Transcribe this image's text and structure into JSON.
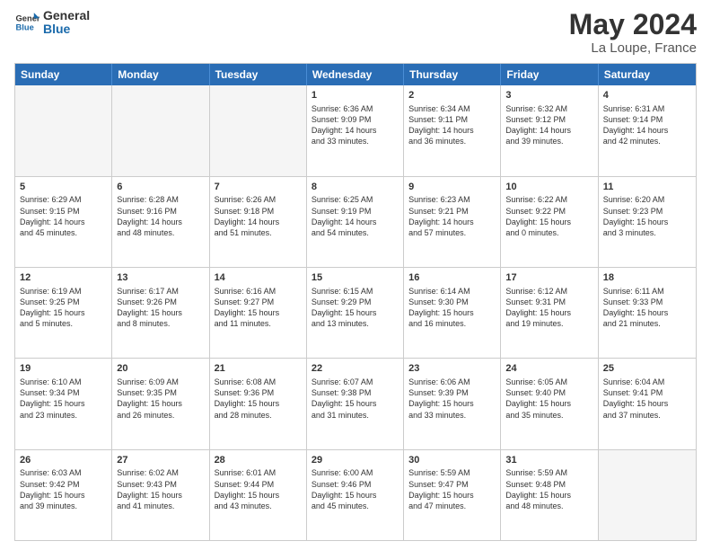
{
  "header": {
    "logo_line1": "General",
    "logo_line2": "Blue",
    "month": "May 2024",
    "location": "La Loupe, France"
  },
  "weekdays": [
    "Sunday",
    "Monday",
    "Tuesday",
    "Wednesday",
    "Thursday",
    "Friday",
    "Saturday"
  ],
  "rows": [
    [
      {
        "day": "",
        "info": ""
      },
      {
        "day": "",
        "info": ""
      },
      {
        "day": "",
        "info": ""
      },
      {
        "day": "1",
        "info": "Sunrise: 6:36 AM\nSunset: 9:09 PM\nDaylight: 14 hours\nand 33 minutes."
      },
      {
        "day": "2",
        "info": "Sunrise: 6:34 AM\nSunset: 9:11 PM\nDaylight: 14 hours\nand 36 minutes."
      },
      {
        "day": "3",
        "info": "Sunrise: 6:32 AM\nSunset: 9:12 PM\nDaylight: 14 hours\nand 39 minutes."
      },
      {
        "day": "4",
        "info": "Sunrise: 6:31 AM\nSunset: 9:14 PM\nDaylight: 14 hours\nand 42 minutes."
      }
    ],
    [
      {
        "day": "5",
        "info": "Sunrise: 6:29 AM\nSunset: 9:15 PM\nDaylight: 14 hours\nand 45 minutes."
      },
      {
        "day": "6",
        "info": "Sunrise: 6:28 AM\nSunset: 9:16 PM\nDaylight: 14 hours\nand 48 minutes."
      },
      {
        "day": "7",
        "info": "Sunrise: 6:26 AM\nSunset: 9:18 PM\nDaylight: 14 hours\nand 51 minutes."
      },
      {
        "day": "8",
        "info": "Sunrise: 6:25 AM\nSunset: 9:19 PM\nDaylight: 14 hours\nand 54 minutes."
      },
      {
        "day": "9",
        "info": "Sunrise: 6:23 AM\nSunset: 9:21 PM\nDaylight: 14 hours\nand 57 minutes."
      },
      {
        "day": "10",
        "info": "Sunrise: 6:22 AM\nSunset: 9:22 PM\nDaylight: 15 hours\nand 0 minutes."
      },
      {
        "day": "11",
        "info": "Sunrise: 6:20 AM\nSunset: 9:23 PM\nDaylight: 15 hours\nand 3 minutes."
      }
    ],
    [
      {
        "day": "12",
        "info": "Sunrise: 6:19 AM\nSunset: 9:25 PM\nDaylight: 15 hours\nand 5 minutes."
      },
      {
        "day": "13",
        "info": "Sunrise: 6:17 AM\nSunset: 9:26 PM\nDaylight: 15 hours\nand 8 minutes."
      },
      {
        "day": "14",
        "info": "Sunrise: 6:16 AM\nSunset: 9:27 PM\nDaylight: 15 hours\nand 11 minutes."
      },
      {
        "day": "15",
        "info": "Sunrise: 6:15 AM\nSunset: 9:29 PM\nDaylight: 15 hours\nand 13 minutes."
      },
      {
        "day": "16",
        "info": "Sunrise: 6:14 AM\nSunset: 9:30 PM\nDaylight: 15 hours\nand 16 minutes."
      },
      {
        "day": "17",
        "info": "Sunrise: 6:12 AM\nSunset: 9:31 PM\nDaylight: 15 hours\nand 19 minutes."
      },
      {
        "day": "18",
        "info": "Sunrise: 6:11 AM\nSunset: 9:33 PM\nDaylight: 15 hours\nand 21 minutes."
      }
    ],
    [
      {
        "day": "19",
        "info": "Sunrise: 6:10 AM\nSunset: 9:34 PM\nDaylight: 15 hours\nand 23 minutes."
      },
      {
        "day": "20",
        "info": "Sunrise: 6:09 AM\nSunset: 9:35 PM\nDaylight: 15 hours\nand 26 minutes."
      },
      {
        "day": "21",
        "info": "Sunrise: 6:08 AM\nSunset: 9:36 PM\nDaylight: 15 hours\nand 28 minutes."
      },
      {
        "day": "22",
        "info": "Sunrise: 6:07 AM\nSunset: 9:38 PM\nDaylight: 15 hours\nand 31 minutes."
      },
      {
        "day": "23",
        "info": "Sunrise: 6:06 AM\nSunset: 9:39 PM\nDaylight: 15 hours\nand 33 minutes."
      },
      {
        "day": "24",
        "info": "Sunrise: 6:05 AM\nSunset: 9:40 PM\nDaylight: 15 hours\nand 35 minutes."
      },
      {
        "day": "25",
        "info": "Sunrise: 6:04 AM\nSunset: 9:41 PM\nDaylight: 15 hours\nand 37 minutes."
      }
    ],
    [
      {
        "day": "26",
        "info": "Sunrise: 6:03 AM\nSunset: 9:42 PM\nDaylight: 15 hours\nand 39 minutes."
      },
      {
        "day": "27",
        "info": "Sunrise: 6:02 AM\nSunset: 9:43 PM\nDaylight: 15 hours\nand 41 minutes."
      },
      {
        "day": "28",
        "info": "Sunrise: 6:01 AM\nSunset: 9:44 PM\nDaylight: 15 hours\nand 43 minutes."
      },
      {
        "day": "29",
        "info": "Sunrise: 6:00 AM\nSunset: 9:46 PM\nDaylight: 15 hours\nand 45 minutes."
      },
      {
        "day": "30",
        "info": "Sunrise: 5:59 AM\nSunset: 9:47 PM\nDaylight: 15 hours\nand 47 minutes."
      },
      {
        "day": "31",
        "info": "Sunrise: 5:59 AM\nSunset: 9:48 PM\nDaylight: 15 hours\nand 48 minutes."
      },
      {
        "day": "",
        "info": ""
      }
    ]
  ]
}
